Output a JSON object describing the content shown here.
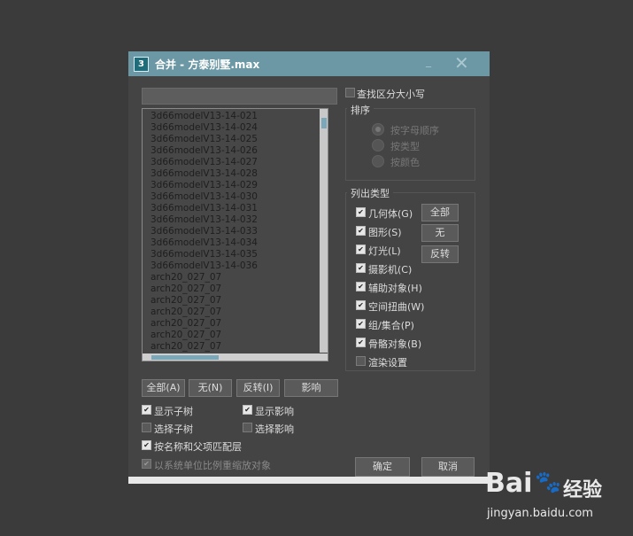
{
  "window": {
    "title": "合并 - 方泰别墅.max",
    "app_icon_label": "3"
  },
  "search": {
    "value": ""
  },
  "case_sensitive": {
    "label": "查找区分大小写",
    "checked": false
  },
  "list_items": [
    "3d66modelV13-14-021",
    "3d66modelV13-14-024",
    "3d66modelV13-14-025",
    "3d66modelV13-14-026",
    "3d66modelV13-14-027",
    "3d66modelV13-14-028",
    "3d66modelV13-14-029",
    "3d66modelV13-14-030",
    "3d66modelV13-14-031",
    "3d66modelV13-14-032",
    "3d66modelV13-14-033",
    "3d66modelV13-14-034",
    "3d66modelV13-14-035",
    "3d66modelV13-14-036",
    "arch20_027_07",
    "arch20_027_07",
    "arch20_027_07",
    "arch20_027_07",
    "arch20_027_07",
    "arch20_027_07",
    "arch20_027_07",
    "arch20_027_07"
  ],
  "sort": {
    "title": "排序",
    "options": [
      {
        "label": "按字母顺序",
        "selected": true
      },
      {
        "label": "按类型",
        "selected": false
      },
      {
        "label": "按颜色",
        "selected": false
      }
    ]
  },
  "list_types": {
    "title": "列出类型",
    "items": [
      {
        "label": "几何体(G)",
        "checked": true
      },
      {
        "label": "图形(S)",
        "checked": true
      },
      {
        "label": "灯光(L)",
        "checked": true
      },
      {
        "label": "摄影机(C)",
        "checked": true
      },
      {
        "label": "辅助对象(H)",
        "checked": true
      },
      {
        "label": "空间扭曲(W)",
        "checked": true
      },
      {
        "label": "组/集合(P)",
        "checked": true
      },
      {
        "label": "骨骼对象(B)",
        "checked": true
      },
      {
        "label": "渲染设置",
        "checked": false
      }
    ],
    "buttons": {
      "all": "全部",
      "none": "无",
      "invert": "反转"
    }
  },
  "list_buttons": {
    "all": "全部(A)",
    "none": "无(N)",
    "invert": "反转(I)",
    "influence": "影响"
  },
  "options": {
    "show_subtree": {
      "label": "显示子树",
      "checked": true
    },
    "show_influence": {
      "label": "显示影响",
      "checked": true
    },
    "select_subtree": {
      "label": "选择子树",
      "checked": false
    },
    "select_influence": {
      "label": "选择影响",
      "checked": false
    },
    "match_name_parent": {
      "label": "按名称和父项匹配层",
      "checked": true
    },
    "scale_by_units": {
      "label": "以系统单位比例重缩放对象",
      "checked": true
    }
  },
  "ok_label": "确定",
  "cancel_label": "取消",
  "watermark": {
    "brand": "Bai",
    "brand2": "百",
    "text": "经验",
    "url": "jingyan.baidu.com"
  }
}
